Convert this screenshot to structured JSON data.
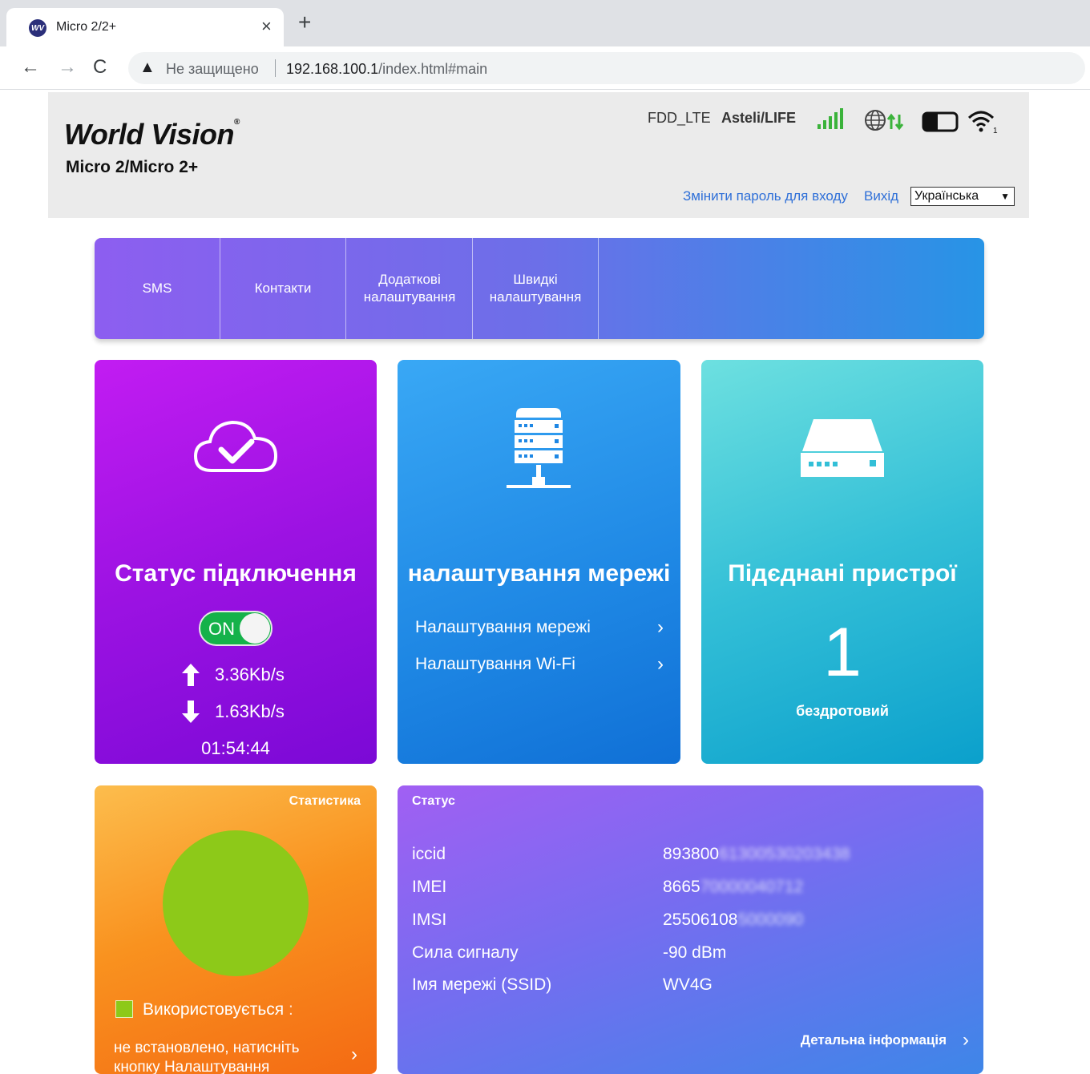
{
  "browser": {
    "tab_title": "Micro 2/2+",
    "favicon_text": "WV",
    "close": "×",
    "new_tab": "+",
    "insecure_label": "Не защищено",
    "url_host": "192.168.100.1",
    "url_path": "/index.html#main"
  },
  "header": {
    "brand": "World Vision",
    "brand_mark": "®",
    "model": "Micro 2/Micro 2+",
    "network_type": "FDD_LTE",
    "operator": "Asteli/LIFE",
    "change_password": "Змінити пароль для входу",
    "logout": "Вихід",
    "language": "Українська"
  },
  "nav": {
    "items": [
      "SMS",
      "Контакти",
      "Додаткові налаштування",
      "Швидкі налаштування"
    ]
  },
  "connection": {
    "title": "Статус підключення",
    "toggle": "ON",
    "upload": "3.36Kb/s",
    "download": "1.63Kb/s",
    "uptime": "01:54:44"
  },
  "network": {
    "title": "налаштування мережі",
    "links": [
      "Налаштування мережі",
      "Налаштування Wi-Fi"
    ]
  },
  "devices": {
    "title": "Підєднані пристрої",
    "count": "1",
    "kind": "бездротовий"
  },
  "stats": {
    "title": "Статистика",
    "legend": "Використовується",
    "legend_sep": ":",
    "note": "не встановлено, натисніть кнопку Налаштування"
  },
  "status": {
    "title": "Статус",
    "rows": [
      {
        "key": "iccid",
        "value": "893800",
        "hidden": "61300530203438"
      },
      {
        "key": "IMEI",
        "value": "8665",
        "hidden": "70000040712"
      },
      {
        "key": "IMSI",
        "value": "25506108",
        "hidden": "5000090"
      },
      {
        "key": "Сила сигналу",
        "value": "-90 dBm"
      },
      {
        "key": "Імя мережі (SSID)",
        "value": "WV4G"
      }
    ],
    "details": "Детальна інформація"
  },
  "colors": {
    "accent_link": "#2e6fd8",
    "signal": "#3bb33b",
    "toggle_on": "#15b24a",
    "pie_used": "#8dc919"
  }
}
